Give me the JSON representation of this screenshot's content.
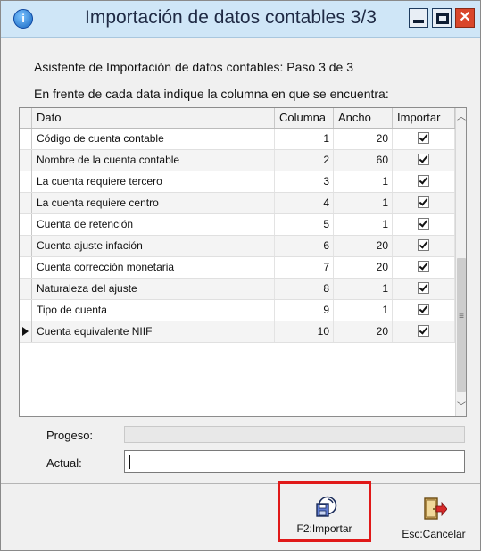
{
  "window": {
    "title": "Importación de datos contables 3/3"
  },
  "wizard": {
    "step_text": "Asistente de Importación de datos contables: Paso 3 de 3",
    "instruction": "En frente de cada data indique la columna en que se encuentra:"
  },
  "grid": {
    "headers": {
      "dato": "Dato",
      "columna": "Columna",
      "ancho": "Ancho",
      "importar": "Importar"
    },
    "rows": [
      {
        "dato": "Código de cuenta contable",
        "columna": "1",
        "ancho": "20",
        "importar": true
      },
      {
        "dato": "Nombre de la cuenta contable",
        "columna": "2",
        "ancho": "60",
        "importar": true
      },
      {
        "dato": "La cuenta requiere tercero",
        "columna": "3",
        "ancho": "1",
        "importar": true
      },
      {
        "dato": "La cuenta requiere centro",
        "columna": "4",
        "ancho": "1",
        "importar": true
      },
      {
        "dato": "Cuenta de retención",
        "columna": "5",
        "ancho": "1",
        "importar": true
      },
      {
        "dato": "Cuenta ajuste infación",
        "columna": "6",
        "ancho": "20",
        "importar": true
      },
      {
        "dato": "Cuenta corrección monetaria",
        "columna": "7",
        "ancho": "20",
        "importar": true
      },
      {
        "dato": "Naturaleza del ajuste",
        "columna": "8",
        "ancho": "1",
        "importar": true
      },
      {
        "dato": "Tipo de cuenta",
        "columna": "9",
        "ancho": "1",
        "importar": true
      },
      {
        "dato": "Cuenta equivalente NIIF",
        "columna": "10",
        "ancho": "20",
        "importar": true
      }
    ],
    "current_row": 9
  },
  "progress": {
    "label": "Progeso:",
    "actual_label": "Actual:",
    "actual_value": ""
  },
  "buttons": {
    "import_label": "F2:Importar",
    "cancel_label": "Esc:Cancelar"
  },
  "icons": {
    "app": "app-info-icon",
    "import": "import-disk-icon",
    "cancel": "exit-door-icon"
  },
  "colors": {
    "titlebar": "#cfe6f7",
    "highlight_border": "#e01919",
    "close_button": "#d9472b"
  }
}
